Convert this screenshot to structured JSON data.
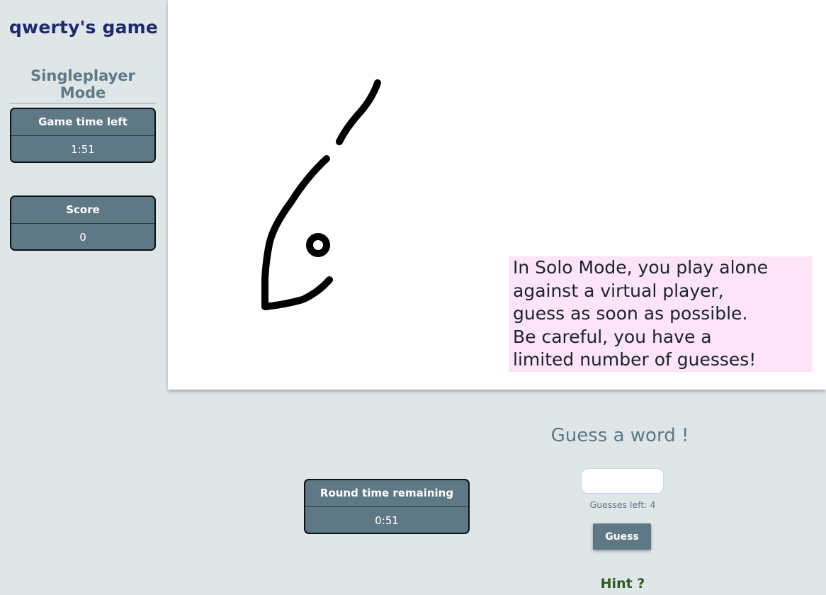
{
  "sidebar": {
    "game_title": "qwerty's game",
    "mode_title": "Singleplayer Mode",
    "game_time": {
      "label": "Game time left",
      "value": "1:51"
    },
    "score": {
      "label": "Score",
      "value": "0"
    }
  },
  "canvas": {
    "instructions": "In Solo Mode, you play alone\nagainst a virtual player,\nguess as soon as possible.\nBe careful, you have a\nlimited number of guesses!"
  },
  "round": {
    "label": "Round time remaining",
    "value": "0:51"
  },
  "guess": {
    "heading": "Guess a word !",
    "input_value": "",
    "input_placeholder": "",
    "guesses_left": "Guesses left: 4",
    "button_label": "Guess",
    "hint_label": "Hint ?"
  },
  "colors": {
    "background": "#dee6e8",
    "panel": "#5f7886",
    "title": "#1e2a6b",
    "hint": "#2e5b23",
    "instructions_bg": "#fde4f6"
  }
}
